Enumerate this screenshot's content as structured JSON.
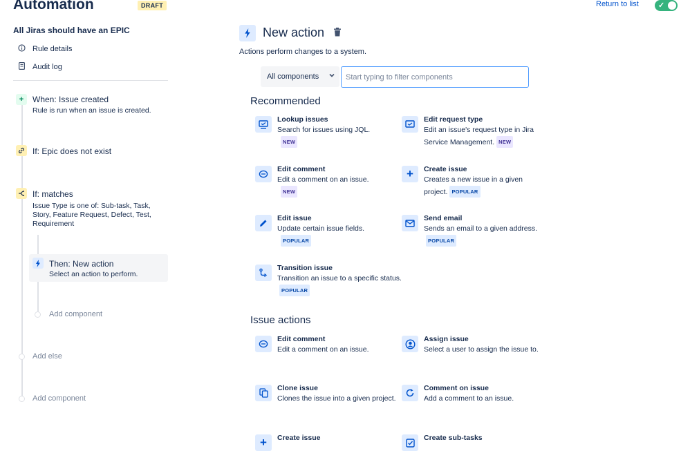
{
  "header": {
    "title": "Automation",
    "badge": "DRAFT",
    "return_link": "Return to list",
    "toggle_check": "✓"
  },
  "sidebar": {
    "rule_name": "All Jiras should have an EPIC",
    "links": [
      {
        "label": "Rule details",
        "icon": "info-icon"
      },
      {
        "label": "Audit log",
        "icon": "document-icon"
      }
    ],
    "steps": [
      {
        "title": "When: Issue created",
        "subtitle": "Rule is run when an issue is created.",
        "icon": "plus-icon",
        "color": "#36B37E"
      },
      {
        "title": "If: Epic does not exist",
        "subtitle": "",
        "icon": "link-icon",
        "color": "#FFAB00"
      },
      {
        "title": "If: matches",
        "subtitle": "Issue Type is one of: Sub-task, Task, Story, Feature Request, Defect, Test, Requirement",
        "icon": "branch-icon",
        "color": "#FFAB00"
      },
      {
        "title": "Then: New action",
        "subtitle": "Select an action to perform.",
        "icon": "bolt-icon",
        "color": "#0052CC"
      }
    ],
    "add_component_inner": "Add component",
    "add_else": "Add else",
    "add_component_outer": "Add component"
  },
  "main": {
    "title": "New action",
    "description": "Actions perform changes to a system.",
    "filter_select": "All components",
    "filter_placeholder": "Start typing to filter components",
    "recommended_heading": "Recommended",
    "issue_actions_heading": "Issue actions",
    "recommended": [
      {
        "title": "Lookup issues",
        "desc": "Search for issues using JQL.",
        "badge": "NEW",
        "icon": "monitor-icon"
      },
      {
        "title": "Edit request type",
        "desc": "Edit an issue's request type in Jira Service Management.",
        "badge": "NEW",
        "icon": "request-type-icon"
      },
      {
        "title": "Edit comment",
        "desc": "Edit a comment on an issue.",
        "badge": "NEW",
        "icon": "comment-icon"
      },
      {
        "title": "Create issue",
        "desc": "Creates a new issue in a given project.",
        "badge": "POPULAR",
        "icon": "plus-icon"
      },
      {
        "title": "Edit issue",
        "desc": "Update certain issue fields.",
        "badge": "POPULAR",
        "icon": "pencil-icon"
      },
      {
        "title": "Send email",
        "desc": "Sends an email to a given address.",
        "badge": "POPULAR",
        "icon": "email-icon"
      },
      {
        "title": "Transition issue",
        "desc": "Transition an issue to a specific status.",
        "badge": "POPULAR",
        "icon": "transition-icon"
      }
    ],
    "issue_actions": [
      {
        "title": "Edit comment",
        "desc": "Edit a comment on an issue.",
        "icon": "comment-icon"
      },
      {
        "title": "Assign issue",
        "desc": "Select a user to assign the issue to.",
        "icon": "user-icon"
      },
      {
        "title": "Clone issue",
        "desc": "Clones the issue into a given project.",
        "icon": "copy-icon"
      },
      {
        "title": "Comment on issue",
        "desc": "Add a comment to an issue.",
        "icon": "refresh-icon"
      },
      {
        "title": "Create issue",
        "desc": "",
        "icon": "plus-icon"
      },
      {
        "title": "Create sub-tasks",
        "desc": "",
        "icon": "checklist-icon"
      }
    ]
  }
}
